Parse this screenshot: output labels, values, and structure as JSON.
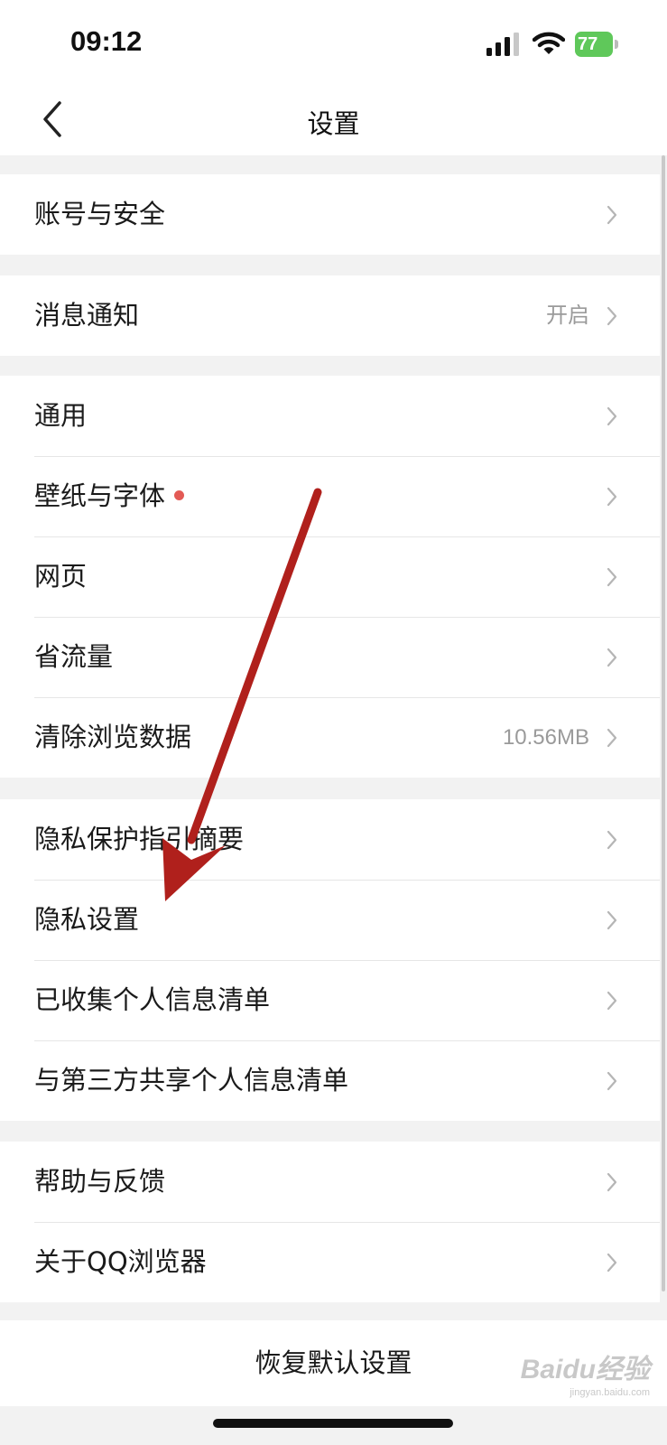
{
  "status_bar": {
    "time": "09:12",
    "battery": "77",
    "icons": [
      "signal-icon",
      "wifi-icon",
      "battery-icon"
    ],
    "battery_color": "#5fc85a"
  },
  "header": {
    "title": "设置",
    "back_icon": "chevron-left-icon"
  },
  "groups": [
    {
      "items": [
        {
          "label": "账号与安全",
          "value": ""
        }
      ]
    },
    {
      "items": [
        {
          "label": "消息通知",
          "value": "开启"
        }
      ]
    },
    {
      "items": [
        {
          "label": "通用",
          "value": ""
        },
        {
          "label": "壁纸与字体",
          "value": "",
          "badge": "red-dot"
        },
        {
          "label": "网页",
          "value": ""
        },
        {
          "label": "省流量",
          "value": ""
        },
        {
          "label": "清除浏览数据",
          "value": "10.56MB"
        }
      ]
    },
    {
      "items": [
        {
          "label": "隐私保护指引摘要",
          "value": ""
        },
        {
          "label": "隐私设置",
          "value": ""
        },
        {
          "label": "已收集个人信息清单",
          "value": ""
        },
        {
          "label": "与第三方共享个人信息清单",
          "value": ""
        }
      ]
    },
    {
      "items": [
        {
          "label": "帮助与反馈",
          "value": ""
        },
        {
          "label": "关于QQ浏览器",
          "value": ""
        }
      ]
    }
  ],
  "footer": {
    "restore_label": "恢复默认设置"
  },
  "annotation": {
    "type": "red-arrow",
    "color": "#b0201c",
    "points_to": "隐私设置"
  },
  "watermark": {
    "brand": "Baidu经验",
    "url": "jingyan.baidu.com"
  },
  "colors": {
    "page_bg": "#f2f2f2",
    "card_bg": "#ffffff",
    "value_text": "#9a9a9a",
    "badge": "#e35a55"
  }
}
